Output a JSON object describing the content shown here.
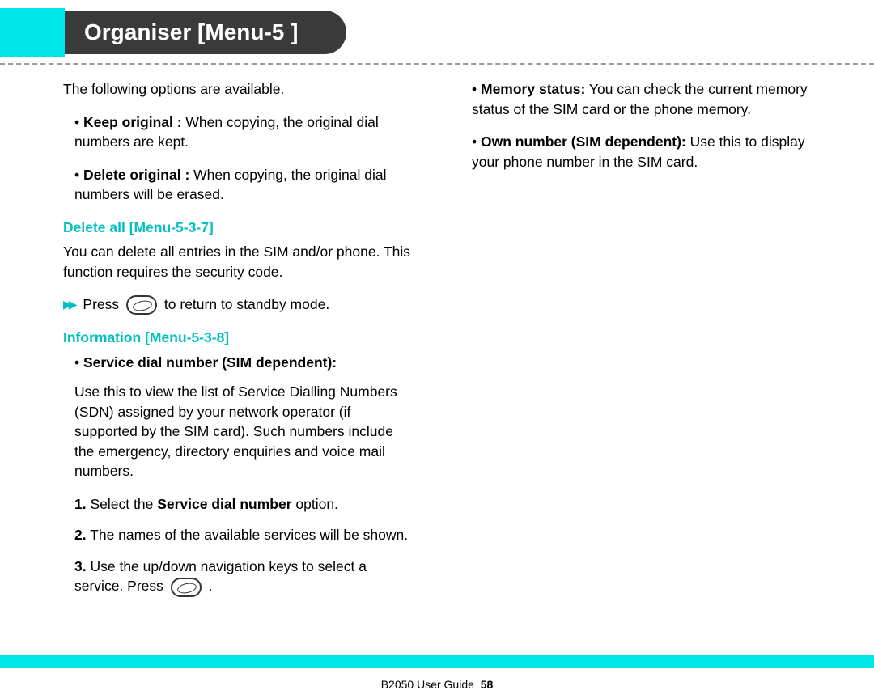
{
  "header": {
    "title": "Organiser [Menu-5 ]"
  },
  "left": {
    "intro": "The following options are available.",
    "opt1_label": "Keep original :",
    "opt1_text": " When copying, the original dial numbers are kept.",
    "opt2_label": "Delete original :",
    "opt2_text": " When copying, the original dial numbers will be erased.",
    "heading1": "Delete all [Menu-5-3-7]",
    "heading1_text": "You can delete all entries in the SIM and/or phone. This function requires the security code.",
    "press_pre": "Press",
    "press_post": "to return to standby mode.",
    "heading2": "Information [Menu-5-3-8]",
    "sdn_label": "Service dial number (SIM dependent):",
    "sdn_text": "Use this to view the list of Service Dialling Numbers (SDN) assigned by your network operator (if supported by the SIM card). Such numbers include the emergency, directory enquiries and voice mail numbers.",
    "step1_pre": "Select the ",
    "step1_bold": "Service dial number",
    "step1_post": " option.",
    "step2": "The names of the available services will be shown.",
    "step3_pre": "Use the up/down navigation keys to select a service. Press",
    "step3_post": "."
  },
  "right": {
    "mem_label": "Memory status:",
    "mem_text": " You can check the current memory status of the SIM card or the phone memory.",
    "own_label": "Own number (SIM dependent):",
    "own_text": " Use this to display your phone number in the SIM card."
  },
  "footer": {
    "guide": "B2050 User Guide",
    "page": "58"
  }
}
